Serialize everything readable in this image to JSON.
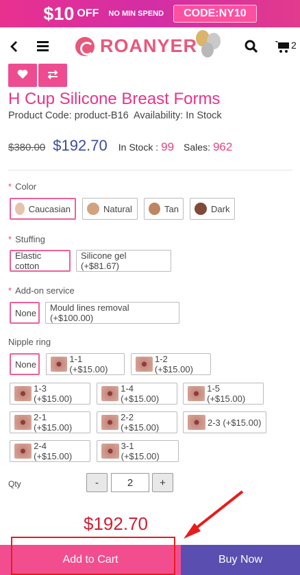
{
  "banner": {
    "amount": "$10",
    "off": "OFF",
    "min_spend": "NO MIN SPEND",
    "code": "CODE:NY10"
  },
  "header": {
    "back_icon": "chevron-left-icon",
    "menu_icon": "hamburger-icon",
    "logo_text": "ROANYER",
    "search_icon": "search-icon",
    "cart_icon": "cart-icon",
    "cart_count": "2"
  },
  "actions": {
    "wishlist_icon": "heart-icon",
    "compare_icon": "compare-arrows-icon"
  },
  "product": {
    "title": "H Cup Silicone Breast Forms",
    "code_line": "Product Code: product-B16  Availability: In Stock",
    "old_price": "$380.00",
    "price": "$192.70",
    "stock_label": "In Stock :",
    "stock_value": "99",
    "sales_label": "Sales:",
    "sales_value": "962"
  },
  "options": {
    "color": {
      "label": "Color",
      "required": "*",
      "items": [
        {
          "label": "Caucasian",
          "swatch": "#e6c3ad",
          "selected": true
        },
        {
          "label": "Natural",
          "swatch": "#d2a37e"
        },
        {
          "label": "Tan",
          "swatch": "#bd8561"
        },
        {
          "label": "Dark",
          "swatch": "#7f4a38"
        }
      ]
    },
    "stuffing": {
      "label": "Stuffing",
      "required": "*",
      "items": [
        {
          "label": "Elastic cotton",
          "selected": true
        },
        {
          "label": "Silicone gel (+$81.67)"
        }
      ]
    },
    "addon": {
      "label": "Add-on service",
      "required": "*",
      "items": [
        {
          "label": "None",
          "selected": true
        },
        {
          "label": "Mould lines removal (+$100.00)"
        }
      ]
    },
    "nipple": {
      "label": "Nipple ring",
      "items": [
        {
          "label": "None",
          "selected": true
        },
        {
          "label": "1-1 (+$15.00)"
        },
        {
          "label": "1-2 (+$15.00)"
        },
        {
          "label": "1-3 (+$15.00)"
        },
        {
          "label": "1-4 (+$15.00)"
        },
        {
          "label": "1-5 (+$15.00)"
        },
        {
          "label": "2-1 (+$15.00)"
        },
        {
          "label": "2-2 (+$15.00)"
        },
        {
          "label": "2-3 (+$15.00)"
        },
        {
          "label": "2-4 (+$15.00)"
        },
        {
          "label": "3-1 (+$15.00)"
        }
      ]
    }
  },
  "qty": {
    "label": "Qty",
    "minus": "-",
    "value": "2",
    "plus": "+"
  },
  "total": "$192.70",
  "buttons": {
    "add_to_cart": "Add to Cart",
    "buy_now": "Buy Now"
  },
  "colors": {
    "brand_pink": "#e6348a",
    "buy_now": "#5a4fb0",
    "add_to_cart": "#f24e8f",
    "highlight": "#e81c1c"
  }
}
